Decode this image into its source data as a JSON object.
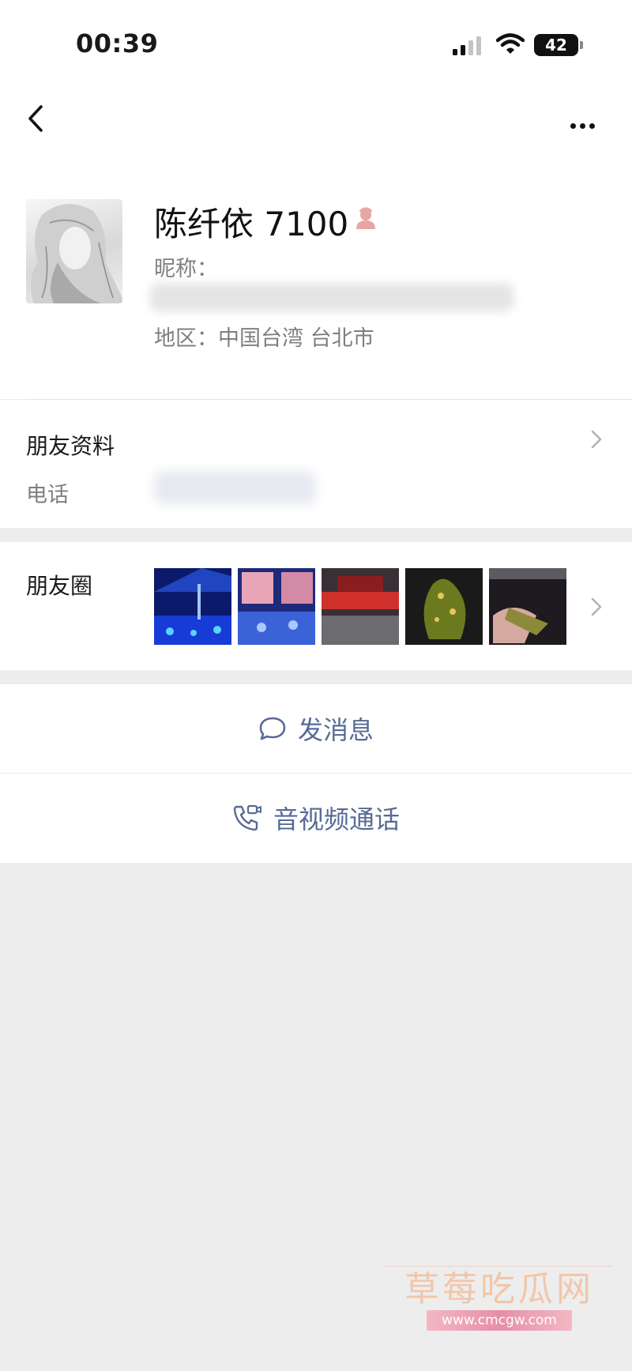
{
  "status_bar": {
    "time": "00:39",
    "battery": "42"
  },
  "profile": {
    "name": "陈纤依 7100",
    "nickname_label": "昵称：",
    "region_label": "地区：中国台湾 台北市"
  },
  "friend_info": {
    "label": "朋友资料",
    "phone_label": "电话"
  },
  "moments": {
    "label": "朋友圈",
    "thumbnails": [
      {
        "name": "concert-stage-blue"
      },
      {
        "name": "concert-screen-vs"
      },
      {
        "name": "concert-red-banner"
      },
      {
        "name": "tree-night"
      },
      {
        "name": "hand-lightstick"
      }
    ]
  },
  "actions": {
    "message": "发消息",
    "call": "音视频通话"
  },
  "watermark": {
    "text": "草莓吃瓜网",
    "url": "www.cmcgw.com"
  },
  "colors": {
    "link": "#576b95",
    "background": "#ededed",
    "gender_icon": "#e8a5a5"
  }
}
